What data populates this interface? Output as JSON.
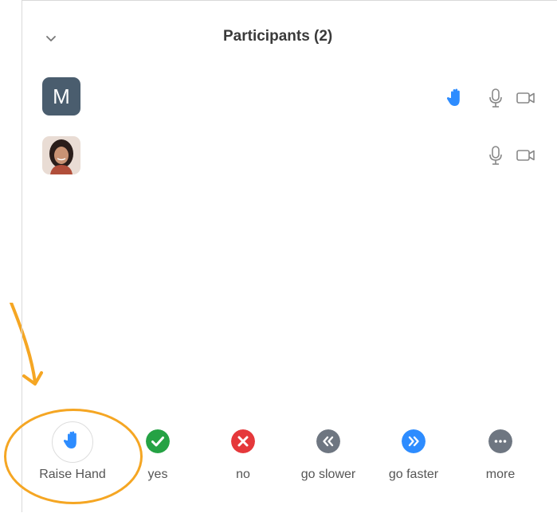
{
  "header": {
    "title": "Participants (2)"
  },
  "participants": [
    {
      "avatar_letter": "M",
      "avatar_color": "#4a5d6e",
      "hand_raised": true
    },
    {
      "avatar_letter": "",
      "avatar_color": "#c49a7a",
      "hand_raised": false
    }
  ],
  "footer": {
    "buttons": [
      {
        "label": "Raise Hand",
        "icon": "hand-icon",
        "color": "#2d8cff"
      },
      {
        "label": "yes",
        "icon": "checkmark-icon",
        "color": "#25a244"
      },
      {
        "label": "no",
        "icon": "x-icon",
        "color": "#e5383b"
      },
      {
        "label": "go slower",
        "icon": "double-chevron-left-icon",
        "color": "#6e7681"
      },
      {
        "label": "go faster",
        "icon": "double-chevron-right-icon",
        "color": "#2d8cff"
      },
      {
        "label": "more",
        "icon": "ellipsis-icon",
        "color": "#6e7681"
      }
    ]
  },
  "colors": {
    "accent": "#2d8cff",
    "highlight": "#f5a623"
  }
}
